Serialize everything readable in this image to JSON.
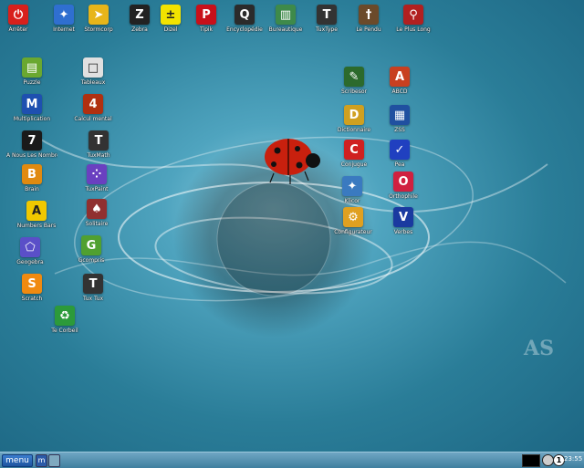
{
  "top_icons": [
    {
      "label": "Arrêter",
      "icon": "power-icon",
      "color": "#d8201c",
      "glyph": "⏻"
    },
    {
      "label": "Internet",
      "icon": "globe-icon",
      "color": "#2f6fd0",
      "glyph": "✦"
    },
    {
      "label": "Stormcorp",
      "icon": "fish-icon",
      "color": "#e7b51a",
      "glyph": "➤"
    },
    {
      "label": "Zebra",
      "icon": "zebra-icon",
      "color": "#222222",
      "glyph": "Z"
    },
    {
      "label": "Dizel",
      "icon": "math-icon",
      "color": "#f2e300",
      "glyph": "±"
    },
    {
      "label": "Tipik",
      "icon": "p-icon",
      "color": "#c8101a",
      "glyph": "P"
    },
    {
      "label": "Encyclopédie",
      "icon": "encyclopedia-icon",
      "color": "#2b2b2b",
      "glyph": "Q"
    },
    {
      "label": "Bureautique",
      "icon": "books-icon",
      "color": "#3e8a4a",
      "glyph": "▥"
    },
    {
      "label": "TuxType",
      "icon": "penguin-icon",
      "color": "#333333",
      "glyph": "T"
    },
    {
      "label": "Le Pendu",
      "icon": "hangman-icon",
      "color": "#6b4a2a",
      "glyph": "†"
    },
    {
      "label": "Le Plus Long",
      "icon": "key-icon",
      "color": "#b12020",
      "glyph": "⚲"
    }
  ],
  "left_icons": [
    {
      "label": "Puzzle",
      "icon": "puzzle-icon",
      "color": "#6aa830",
      "glyph": "▤"
    },
    {
      "label": "Multiplication",
      "icon": "m-icon",
      "color": "#1e50b0",
      "glyph": "M"
    },
    {
      "label": "A Nous Les Nombres",
      "icon": "numbers-icon",
      "color": "#1a1a1a",
      "glyph": "7"
    },
    {
      "label": "Brain",
      "icon": "brain-icon",
      "color": "#e08a10",
      "glyph": "B"
    },
    {
      "label": "Numbers Bars",
      "icon": "bars-icon",
      "color": "#f0c800",
      "glyph": "A"
    },
    {
      "label": "Geogebra",
      "icon": "geogebra-icon",
      "color": "#5a4fc8",
      "glyph": "⬠"
    },
    {
      "label": "Scratch",
      "icon": "cat-icon",
      "color": "#f08a10",
      "glyph": "S"
    },
    {
      "label": "Tableaux",
      "icon": "tiles-icon",
      "color": "#e0e0e0",
      "glyph": "□"
    },
    {
      "label": "Calcul mental",
      "icon": "calc-icon",
      "color": "#b03010",
      "glyph": "4"
    },
    {
      "label": "TuxMath",
      "icon": "penguin-math-icon",
      "color": "#333333",
      "glyph": "T"
    },
    {
      "label": "TuxPaint",
      "icon": "dots-icon",
      "color": "#6a40c0",
      "glyph": "⁘"
    },
    {
      "label": "Solitaire",
      "icon": "cards-icon",
      "color": "#903030",
      "glyph": "♠"
    },
    {
      "label": "Gcompris",
      "icon": "gcompris-icon",
      "color": "#50a030",
      "glyph": "G"
    },
    {
      "label": "Tux Tux",
      "icon": "tux-icon",
      "color": "#333333",
      "glyph": "T"
    },
    {
      "label": "Te Corbeil",
      "icon": "recycle-icon",
      "color": "#2c9a3a",
      "glyph": "♻"
    }
  ],
  "right_icons": [
    {
      "label": "Scribesor",
      "icon": "board-icon",
      "color": "#2c6a2c",
      "glyph": "✎"
    },
    {
      "label": "ABCD",
      "icon": "abcd-icon",
      "color": "#c84020",
      "glyph": "A"
    },
    {
      "label": "Dictionnaire",
      "icon": "dictionary-icon",
      "color": "#d0a020",
      "glyph": "D"
    },
    {
      "label": "ZSS",
      "icon": "grid-icon",
      "color": "#2050a0",
      "glyph": "▦"
    },
    {
      "label": "Conjugue",
      "icon": "conjugate-icon",
      "color": "#d02020",
      "glyph": "C"
    },
    {
      "label": "Pea",
      "icon": "pencil-icon",
      "color": "#2040c0",
      "glyph": "✓"
    },
    {
      "label": "Klicor",
      "icon": "lamp-icon",
      "color": "#3a7ac0",
      "glyph": "✦"
    },
    {
      "label": "Orthophile",
      "icon": "ortho-icon",
      "color": "#d02040",
      "glyph": "O"
    },
    {
      "label": "Configurateur",
      "icon": "config-icon",
      "color": "#e0a020",
      "glyph": "⚙"
    },
    {
      "label": "Verbes",
      "icon": "v-icon",
      "color": "#1a3aa0",
      "glyph": "V"
    }
  ],
  "taskbar": {
    "menu_label": "menu",
    "task_label": "m",
    "clock": "23:55"
  },
  "watermark": "AS"
}
